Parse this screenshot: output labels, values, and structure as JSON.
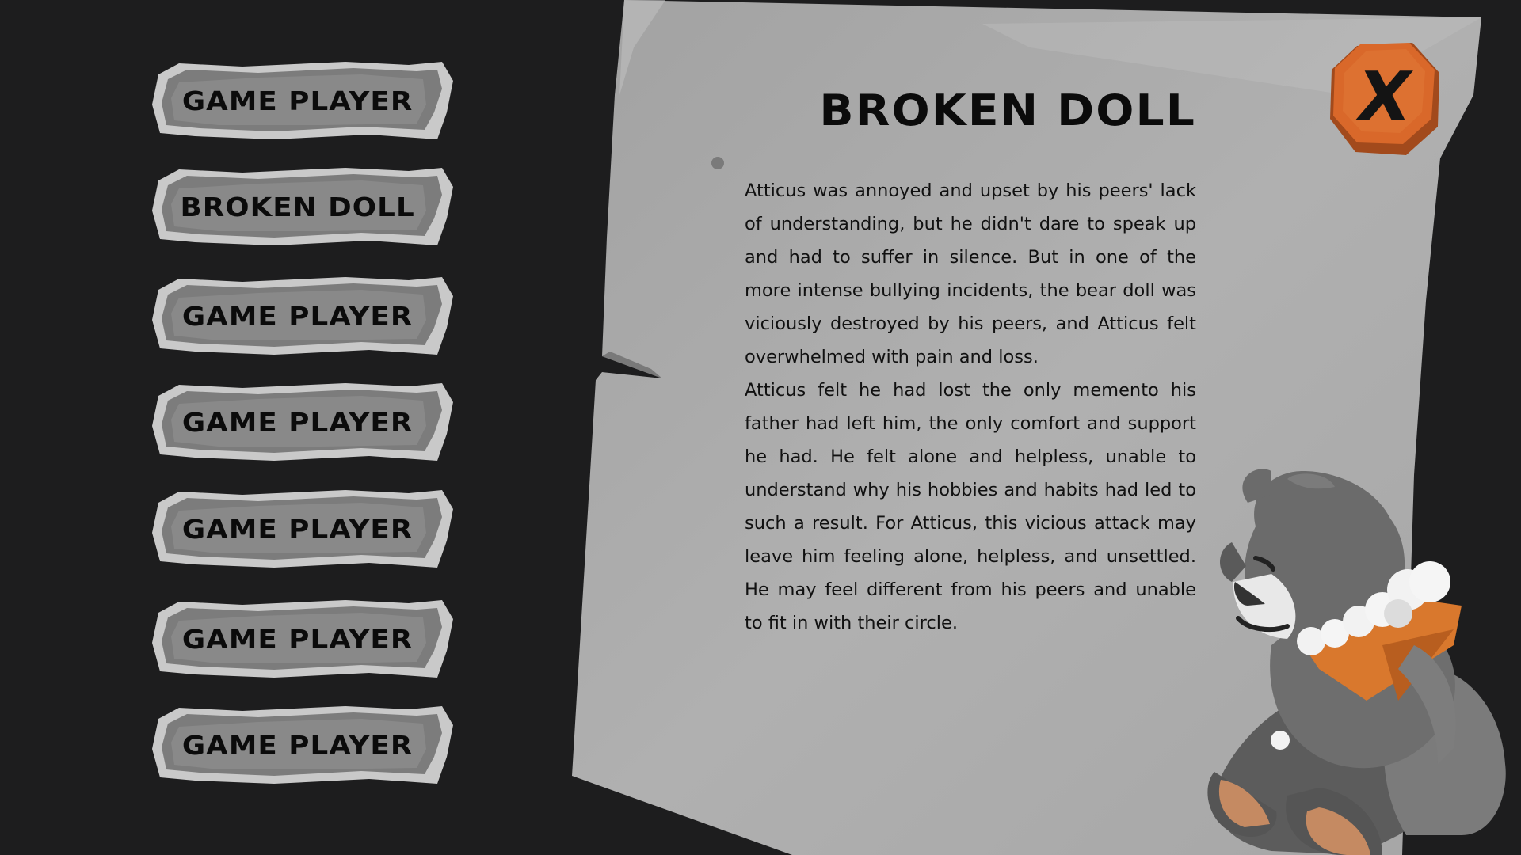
{
  "menu": {
    "items": [
      {
        "label": "GAME PLAYER"
      },
      {
        "label": "BROKEN DOLL"
      },
      {
        "label": "GAME PLAYER"
      },
      {
        "label": "GAME PLAYER"
      },
      {
        "label": "GAME PLAYER"
      },
      {
        "label": "GAME PLAYER"
      },
      {
        "label": "GAME PLAYER"
      }
    ]
  },
  "panel": {
    "title": "BROKEN DOLL",
    "paragraphs": [
      "Atticus was annoyed and upset by his peers' lack of understanding, but he didn't dare to speak up and had to suffer in silence. But in one of the more intense bullying incidents, the bear doll was viciously destroyed by his peers, and Atticus felt overwhelmed with pain and loss.",
      "Atticus felt he had lost the only memento his father had left him, the only comfort and support he had. He felt alone and helpless, unable to understand why his hobbies and habits had led to such a result. For Atticus, this vicious attack may leave him feeling alone, helpless, and unsettled. He may feel different from his peers and unable to fit in with their circle."
    ]
  },
  "close": {
    "label": "X",
    "icon": "close-icon"
  },
  "colors": {
    "background": "#1d1d1e",
    "paper": "#a9a9a9",
    "accent_orange": "#d9682a",
    "text": "#111111"
  }
}
